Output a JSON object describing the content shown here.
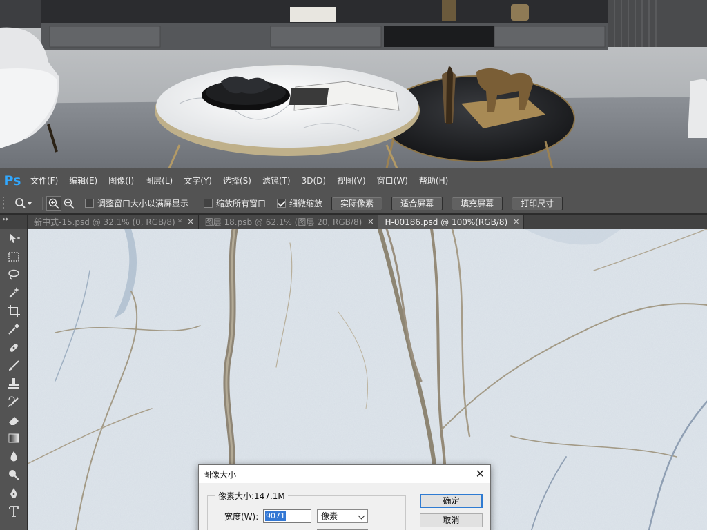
{
  "app": {
    "logo_text": "Ps"
  },
  "menu": {
    "items": [
      "文件(F)",
      "编辑(E)",
      "图像(I)",
      "图层(L)",
      "文字(Y)",
      "选择(S)",
      "滤镜(T)",
      "3D(D)",
      "视图(V)",
      "窗口(W)",
      "帮助(H)"
    ]
  },
  "options": {
    "tool_icon": "zoom-icon",
    "checkboxes": [
      {
        "label": "调整窗口大小以满屏显示",
        "checked": false
      },
      {
        "label": "缩放所有窗口",
        "checked": false
      },
      {
        "label": "细微缩放",
        "checked": true
      }
    ],
    "buttons": [
      "实际像素",
      "适合屏幕",
      "填充屏幕",
      "打印尺寸"
    ]
  },
  "tabs": [
    {
      "title": "新中式-15.psd @ 32.1% (0, RGB/8) *",
      "active": false
    },
    {
      "title": "图层 18.psb @ 62.1% (图层 20, RGB/8)",
      "active": false
    },
    {
      "title": "H-00186.psd @ 100%(RGB/8)",
      "active": true
    }
  ],
  "toolbar": {
    "header": "▸▸",
    "tools": [
      "move-icon",
      "marquee-icon",
      "lasso-icon",
      "magic-wand-icon",
      "crop-icon",
      "eyedropper-icon",
      "healing-brush-icon",
      "brush-icon",
      "clone-stamp-icon",
      "history-brush-icon",
      "eraser-icon",
      "gradient-icon",
      "blur-icon",
      "dodge-icon",
      "pen-icon",
      "type-icon"
    ]
  },
  "dialog": {
    "title": "图像大小",
    "close": "✕",
    "pixel_size_label": "像素大小:147.1M",
    "width_label": "宽度(W):",
    "width_value": "9071",
    "unit": "像素",
    "ok": "确定",
    "cancel": "取消"
  },
  "colors": {
    "chrome": "#535353",
    "ps_blue": "#31a8ff",
    "canvas_marble": "#dde4ea",
    "vein": "#9a8f7e",
    "dialog_accent": "#2f7bd2"
  }
}
